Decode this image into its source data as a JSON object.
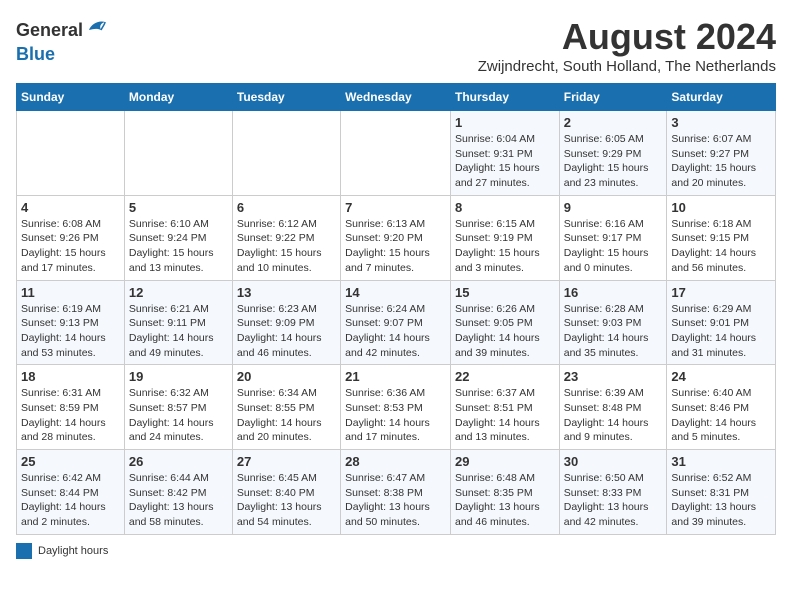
{
  "header": {
    "logo_general": "General",
    "logo_blue": "Blue",
    "month_year": "August 2024",
    "location": "Zwijndrecht, South Holland, The Netherlands"
  },
  "days_of_week": [
    "Sunday",
    "Monday",
    "Tuesday",
    "Wednesday",
    "Thursday",
    "Friday",
    "Saturday"
  ],
  "weeks": [
    [
      {
        "day": "",
        "info": ""
      },
      {
        "day": "",
        "info": ""
      },
      {
        "day": "",
        "info": ""
      },
      {
        "day": "",
        "info": ""
      },
      {
        "day": "1",
        "info": "Sunrise: 6:04 AM\nSunset: 9:31 PM\nDaylight: 15 hours and 27 minutes."
      },
      {
        "day": "2",
        "info": "Sunrise: 6:05 AM\nSunset: 9:29 PM\nDaylight: 15 hours and 23 minutes."
      },
      {
        "day": "3",
        "info": "Sunrise: 6:07 AM\nSunset: 9:27 PM\nDaylight: 15 hours and 20 minutes."
      }
    ],
    [
      {
        "day": "4",
        "info": "Sunrise: 6:08 AM\nSunset: 9:26 PM\nDaylight: 15 hours and 17 minutes."
      },
      {
        "day": "5",
        "info": "Sunrise: 6:10 AM\nSunset: 9:24 PM\nDaylight: 15 hours and 13 minutes."
      },
      {
        "day": "6",
        "info": "Sunrise: 6:12 AM\nSunset: 9:22 PM\nDaylight: 15 hours and 10 minutes."
      },
      {
        "day": "7",
        "info": "Sunrise: 6:13 AM\nSunset: 9:20 PM\nDaylight: 15 hours and 7 minutes."
      },
      {
        "day": "8",
        "info": "Sunrise: 6:15 AM\nSunset: 9:19 PM\nDaylight: 15 hours and 3 minutes."
      },
      {
        "day": "9",
        "info": "Sunrise: 6:16 AM\nSunset: 9:17 PM\nDaylight: 15 hours and 0 minutes."
      },
      {
        "day": "10",
        "info": "Sunrise: 6:18 AM\nSunset: 9:15 PM\nDaylight: 14 hours and 56 minutes."
      }
    ],
    [
      {
        "day": "11",
        "info": "Sunrise: 6:19 AM\nSunset: 9:13 PM\nDaylight: 14 hours and 53 minutes."
      },
      {
        "day": "12",
        "info": "Sunrise: 6:21 AM\nSunset: 9:11 PM\nDaylight: 14 hours and 49 minutes."
      },
      {
        "day": "13",
        "info": "Sunrise: 6:23 AM\nSunset: 9:09 PM\nDaylight: 14 hours and 46 minutes."
      },
      {
        "day": "14",
        "info": "Sunrise: 6:24 AM\nSunset: 9:07 PM\nDaylight: 14 hours and 42 minutes."
      },
      {
        "day": "15",
        "info": "Sunrise: 6:26 AM\nSunset: 9:05 PM\nDaylight: 14 hours and 39 minutes."
      },
      {
        "day": "16",
        "info": "Sunrise: 6:28 AM\nSunset: 9:03 PM\nDaylight: 14 hours and 35 minutes."
      },
      {
        "day": "17",
        "info": "Sunrise: 6:29 AM\nSunset: 9:01 PM\nDaylight: 14 hours and 31 minutes."
      }
    ],
    [
      {
        "day": "18",
        "info": "Sunrise: 6:31 AM\nSunset: 8:59 PM\nDaylight: 14 hours and 28 minutes."
      },
      {
        "day": "19",
        "info": "Sunrise: 6:32 AM\nSunset: 8:57 PM\nDaylight: 14 hours and 24 minutes."
      },
      {
        "day": "20",
        "info": "Sunrise: 6:34 AM\nSunset: 8:55 PM\nDaylight: 14 hours and 20 minutes."
      },
      {
        "day": "21",
        "info": "Sunrise: 6:36 AM\nSunset: 8:53 PM\nDaylight: 14 hours and 17 minutes."
      },
      {
        "day": "22",
        "info": "Sunrise: 6:37 AM\nSunset: 8:51 PM\nDaylight: 14 hours and 13 minutes."
      },
      {
        "day": "23",
        "info": "Sunrise: 6:39 AM\nSunset: 8:48 PM\nDaylight: 14 hours and 9 minutes."
      },
      {
        "day": "24",
        "info": "Sunrise: 6:40 AM\nSunset: 8:46 PM\nDaylight: 14 hours and 5 minutes."
      }
    ],
    [
      {
        "day": "25",
        "info": "Sunrise: 6:42 AM\nSunset: 8:44 PM\nDaylight: 14 hours and 2 minutes."
      },
      {
        "day": "26",
        "info": "Sunrise: 6:44 AM\nSunset: 8:42 PM\nDaylight: 13 hours and 58 minutes."
      },
      {
        "day": "27",
        "info": "Sunrise: 6:45 AM\nSunset: 8:40 PM\nDaylight: 13 hours and 54 minutes."
      },
      {
        "day": "28",
        "info": "Sunrise: 6:47 AM\nSunset: 8:38 PM\nDaylight: 13 hours and 50 minutes."
      },
      {
        "day": "29",
        "info": "Sunrise: 6:48 AM\nSunset: 8:35 PM\nDaylight: 13 hours and 46 minutes."
      },
      {
        "day": "30",
        "info": "Sunrise: 6:50 AM\nSunset: 8:33 PM\nDaylight: 13 hours and 42 minutes."
      },
      {
        "day": "31",
        "info": "Sunrise: 6:52 AM\nSunset: 8:31 PM\nDaylight: 13 hours and 39 minutes."
      }
    ]
  ],
  "legend": {
    "box_label": "Daylight hours"
  }
}
